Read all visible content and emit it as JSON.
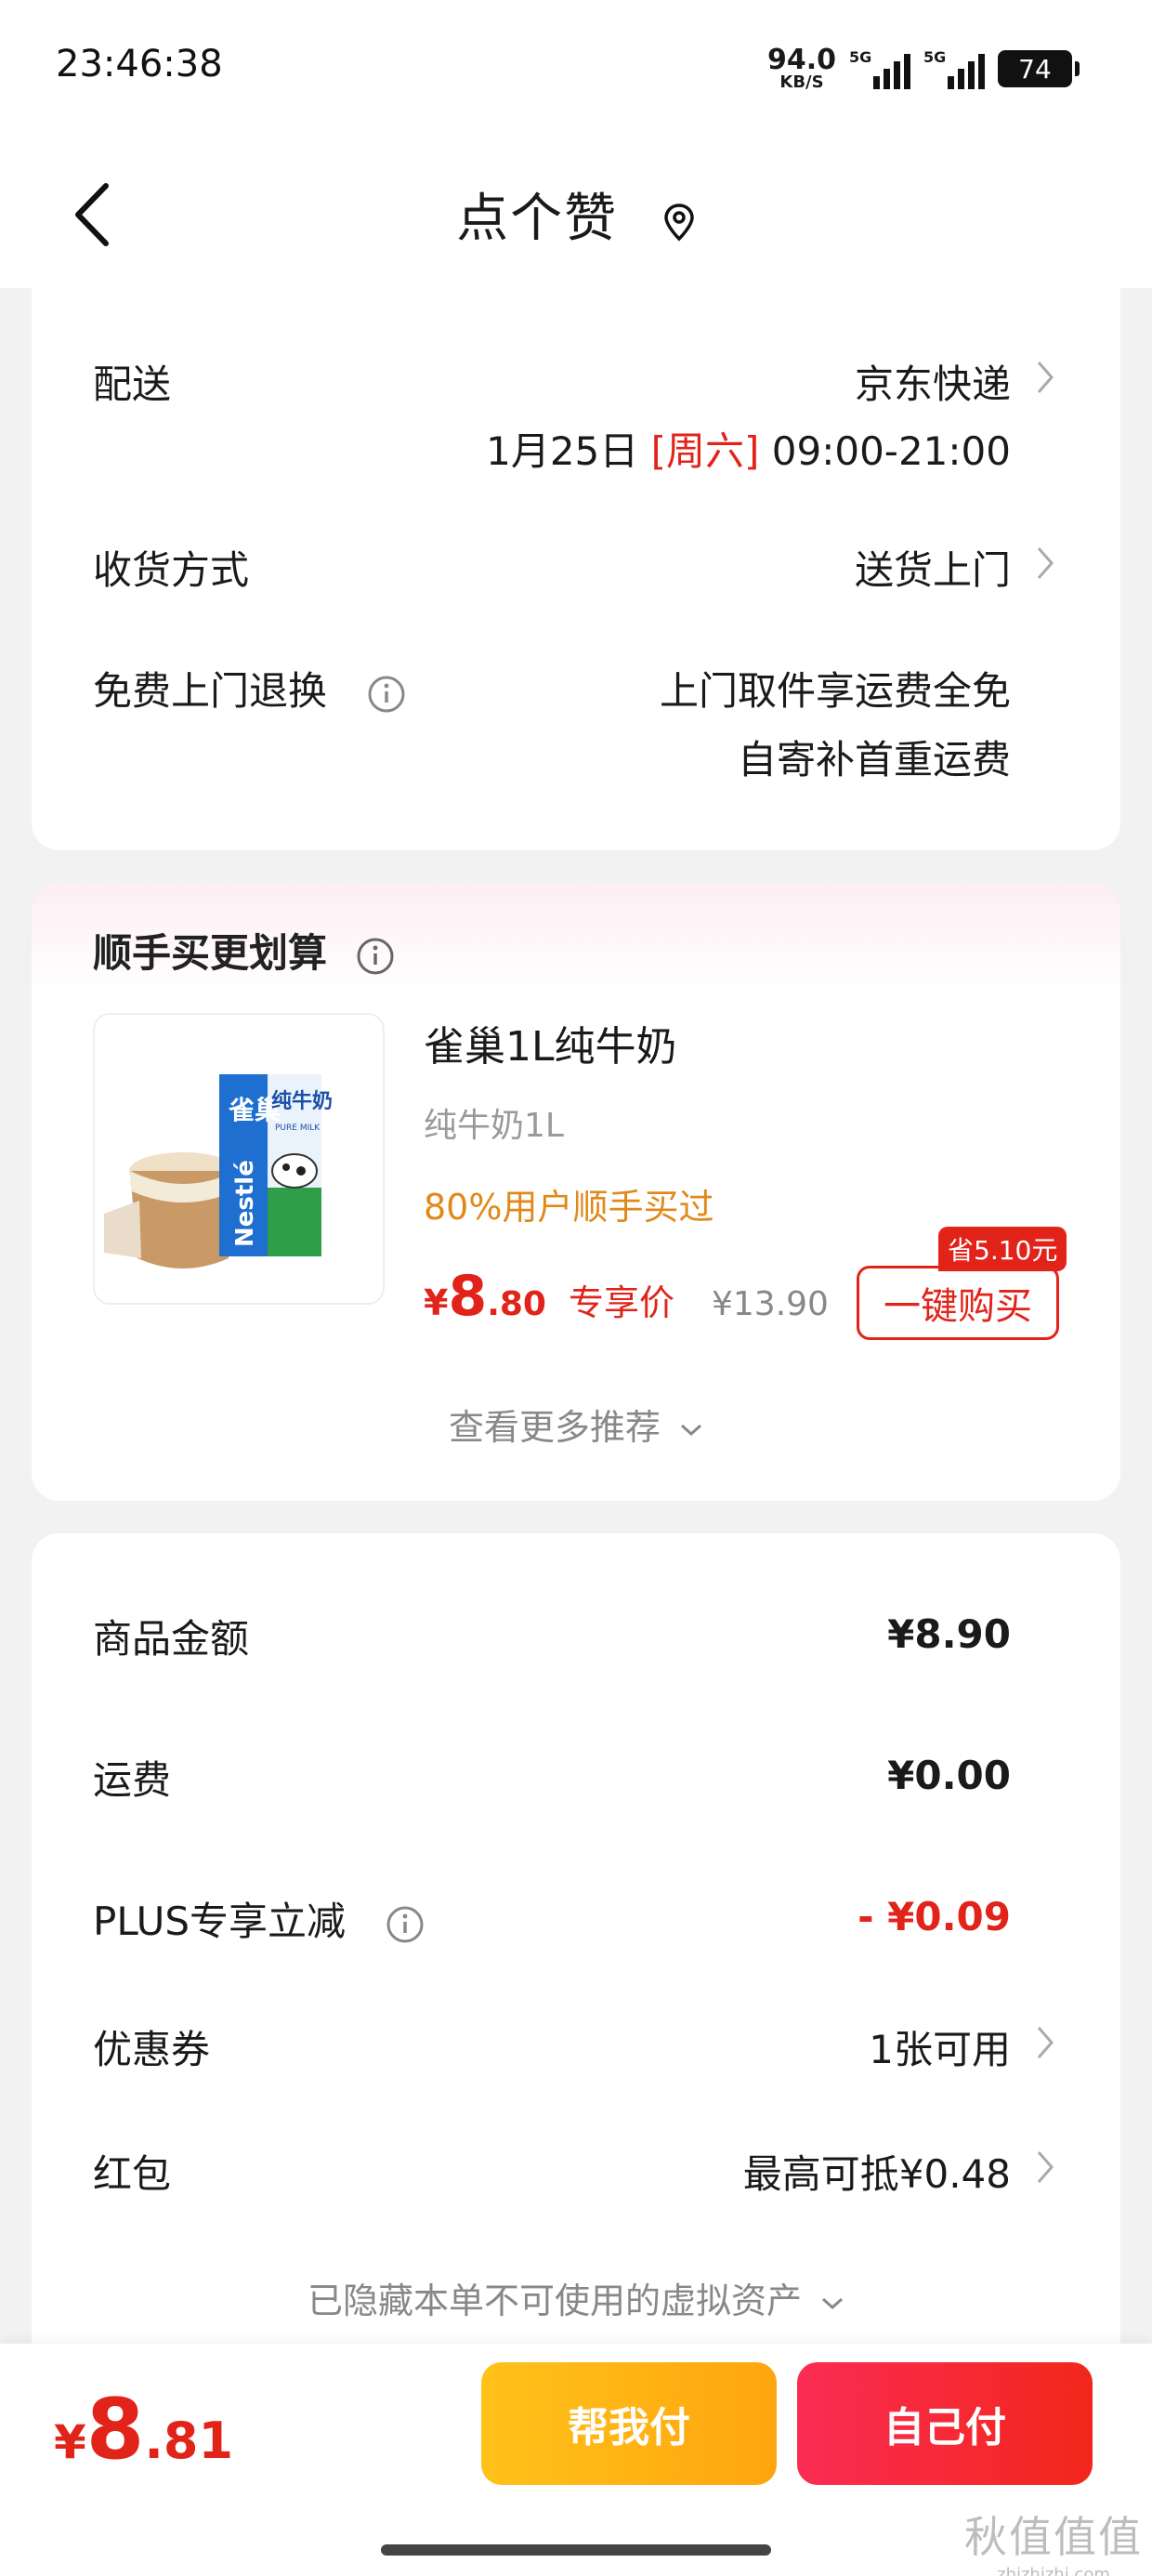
{
  "status_bar": {
    "time": "23:46:38",
    "net_speed": "94.0",
    "net_unit": "KB/S",
    "signal1_label": "5G",
    "signal2_label": "5G",
    "battery": "74"
  },
  "nav": {
    "title": "点个赞",
    "back_icon": "chevron-left-icon",
    "location_icon": "location-pin-icon"
  },
  "delivery": {
    "label": "配送",
    "carrier": "京东快递",
    "date": "1月25日",
    "weekday": "[周六]",
    "time_range": "09:00-21:00",
    "receive_label": "收货方式",
    "receive_value": "送货上门",
    "return_label": "免费上门退换",
    "return_line1": "上门取件享运费全免",
    "return_line2": "自寄补首重运费"
  },
  "recommend": {
    "title": "顺手买更划算",
    "product": {
      "name": "雀巢1L纯牛奶",
      "spec": "纯牛奶1L",
      "tag": "80%用户顺手买过",
      "price_currency": "¥",
      "price_int": "8",
      "price_dec": ".80",
      "price_label": "专享价",
      "orig_price": "¥13.90",
      "save_badge": "省5.10元",
      "buy_label": "一键购买",
      "box_text_brand": "雀巢",
      "box_text_name": "纯牛奶",
      "box_text_en": "PURE MILK",
      "box_text_logo": "Nestlé"
    },
    "see_more": "查看更多推荐"
  },
  "summary": {
    "goods_label": "商品金额",
    "goods_value": "¥8.90",
    "shipping_label": "运费",
    "shipping_value": "¥0.00",
    "plus_label": "PLUS专享立减",
    "plus_value": "- ¥0.09",
    "coupon_label": "优惠券",
    "coupon_value": "1张可用",
    "redpacket_label": "红包",
    "redpacket_value": "最高可抵¥0.48",
    "hidden_note": "已隐藏本单不可使用的虚拟资产"
  },
  "bottom": {
    "total_currency": "¥",
    "total_int": "8",
    "total_dec": ".81",
    "help_pay": "帮我付",
    "self_pay": "自己付",
    "watermark_main": "秋值值值",
    "watermark_sub": "zhizhizhi.com"
  },
  "colors": {
    "accent_red": "#e2231a",
    "tag_orange": "#e0891a",
    "help_button": "#ffb414",
    "self_button": "#f5283a"
  }
}
